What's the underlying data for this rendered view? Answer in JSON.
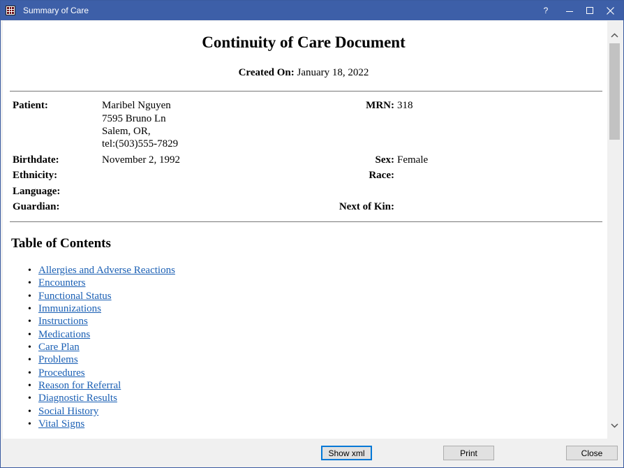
{
  "window": {
    "title": "Summary of Care",
    "help_label": "?"
  },
  "document": {
    "title": "Continuity of Care Document",
    "created_label": "Created On:",
    "created_value": "January 18, 2022",
    "patient": {
      "patient_label": "Patient:",
      "name": "Maribel Nguyen",
      "address_line1": "7595 Bruno Ln",
      "address_line2": "Salem, OR,",
      "phone": "tel:(503)555-7829",
      "mrn_label": "MRN:",
      "mrn_value": "318",
      "birthdate_label": "Birthdate:",
      "birthdate_value": "November 2, 1992",
      "sex_label": "Sex:",
      "sex_value": "Female",
      "ethnicity_label": "Ethnicity:",
      "race_label": "Race:",
      "language_label": "Language:",
      "guardian_label": "Guardian:",
      "next_of_kin_label": "Next of Kin:"
    },
    "toc": {
      "title": "Table of Contents",
      "bullet": "•",
      "items": [
        "Allergies and Adverse Reactions",
        "Encounters",
        "Functional Status",
        "Immunizations",
        "Instructions",
        "Medications",
        "Care Plan",
        "Problems",
        "Procedures",
        "Reason for Referral",
        "Diagnostic Results",
        "Social History",
        "Vital Signs"
      ]
    }
  },
  "footer": {
    "show_xml_label": "Show xml",
    "print_label": "Print",
    "close_label": "Close"
  },
  "icons": {
    "app_icon": "grid-app-icon",
    "scroll_up": "chevron-up-icon",
    "scroll_down": "chevron-down-icon"
  }
}
